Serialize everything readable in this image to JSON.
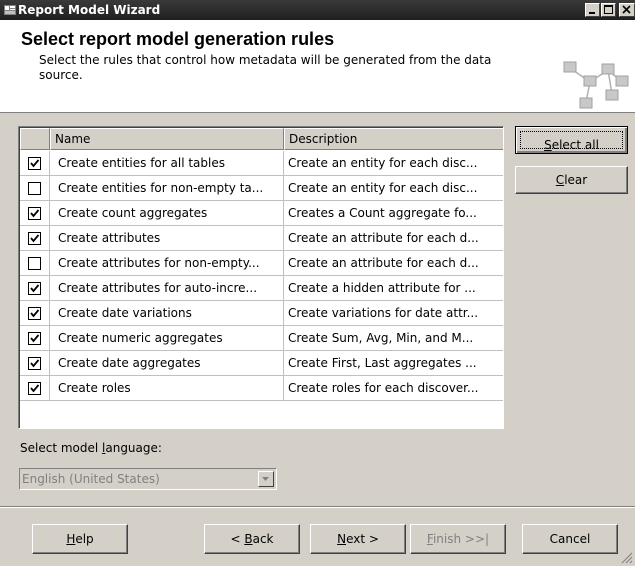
{
  "window": {
    "title": "Report Model Wizard",
    "icon": "wizard-app-icon"
  },
  "header": {
    "title": "Select report model generation rules",
    "description": "Select the rules that control how metadata will be generated from the data source."
  },
  "grid": {
    "columns": [
      "Name",
      "Description"
    ],
    "rows": [
      {
        "checked": true,
        "name": "Create entities for all tables",
        "description": "Create an entity for each disc..."
      },
      {
        "checked": false,
        "name": "Create entities for non-empty ta...",
        "description": "Create an entity for each disc..."
      },
      {
        "checked": true,
        "name": "Create count aggregates",
        "description": "Creates a Count aggregate fo..."
      },
      {
        "checked": true,
        "name": "Create attributes",
        "description": "Create an attribute for each d..."
      },
      {
        "checked": false,
        "name": "Create attributes for non-empty...",
        "description": "Create an attribute for each d..."
      },
      {
        "checked": true,
        "name": "Create attributes for auto-incre...",
        "description": "Create a hidden attribute for ..."
      },
      {
        "checked": true,
        "name": "Create date variations",
        "description": "Create variations for date attr..."
      },
      {
        "checked": true,
        "name": "Create numeric aggregates",
        "description": "Create Sum, Avg, Min, and M..."
      },
      {
        "checked": true,
        "name": "Create date aggregates",
        "description": "Create First, Last aggregates ..."
      },
      {
        "checked": true,
        "name": "Create roles",
        "description": "Create roles for each discover..."
      }
    ]
  },
  "buttons": {
    "select_all": {
      "pre": "",
      "key": "S",
      "post": "elect all"
    },
    "clear": {
      "pre": "",
      "key": "C",
      "post": "lear"
    },
    "help": {
      "pre": "",
      "key": "H",
      "post": "elp"
    },
    "back": {
      "pre": "< ",
      "key": "B",
      "post": "ack"
    },
    "next": {
      "pre": "",
      "key": "N",
      "post": "ext >"
    },
    "finish": {
      "pre": "",
      "key": "F",
      "post": "inish >>|"
    },
    "cancel": {
      "pre": "Cancel",
      "key": "",
      "post": ""
    }
  },
  "language": {
    "label_pre": "Select model ",
    "label_key": "l",
    "label_post": "anguage:",
    "value": "English (United States)"
  }
}
